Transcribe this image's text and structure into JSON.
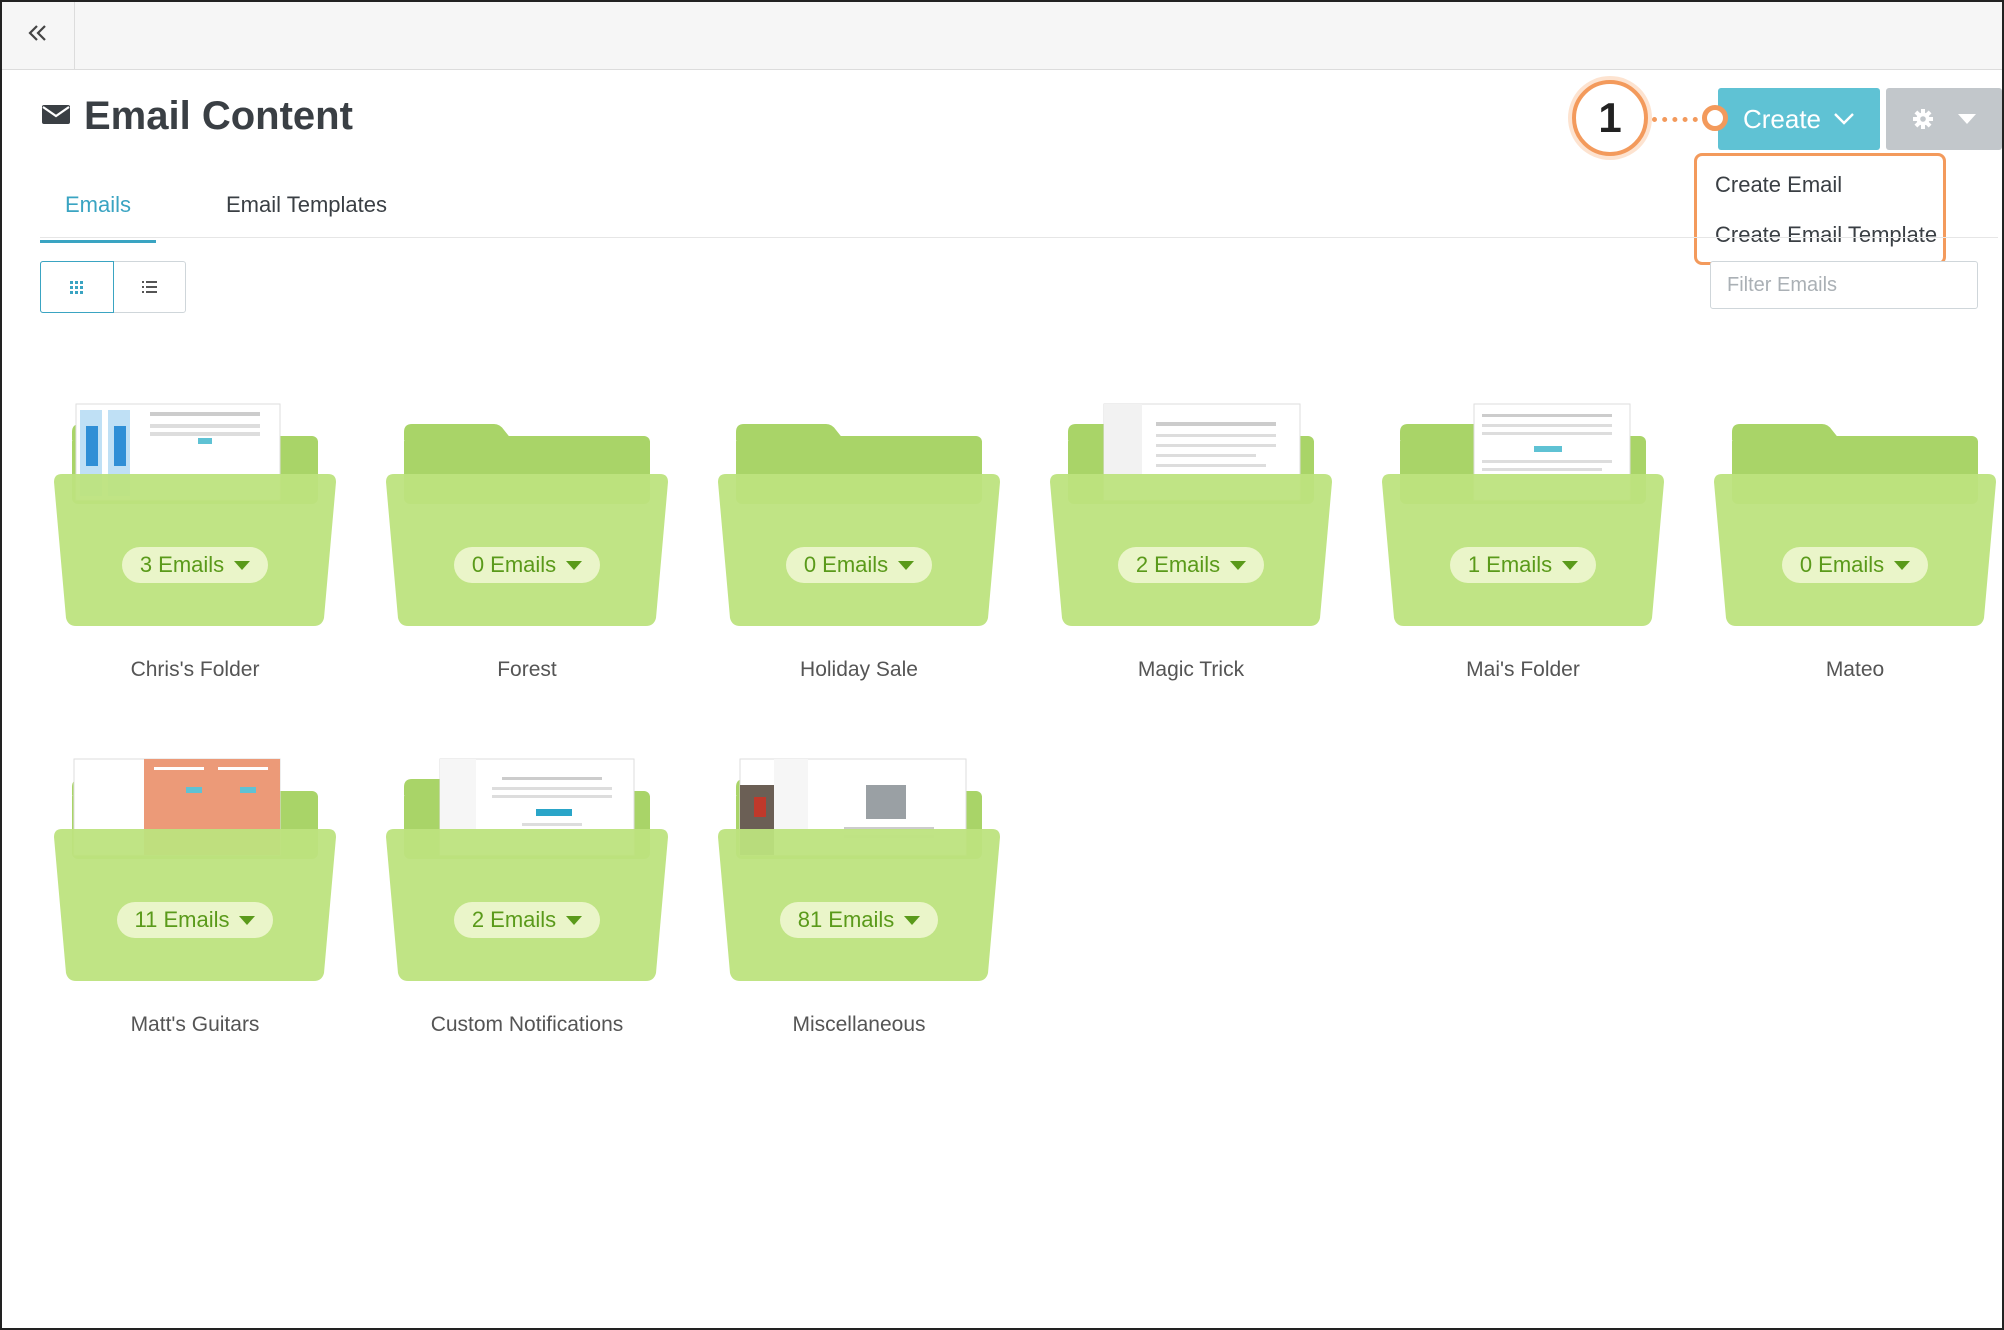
{
  "header": {
    "title": "Email Content"
  },
  "tabs": [
    {
      "label": "Emails",
      "active": true
    },
    {
      "label": "Email Templates",
      "active": false
    }
  ],
  "toolbar": {
    "create_label": "Create",
    "create_menu": [
      "Create Email",
      "Create Email Template"
    ],
    "filter_placeholder": "Filter Emails"
  },
  "callout": {
    "number": "1"
  },
  "folders": [
    {
      "name": "Chris's Folder",
      "count": "3 Emails"
    },
    {
      "name": "Forest",
      "count": "0 Emails"
    },
    {
      "name": "Holiday Sale",
      "count": "0 Emails"
    },
    {
      "name": "Magic Trick",
      "count": "2 Emails"
    },
    {
      "name": "Mai's Folder",
      "count": "1 Emails"
    },
    {
      "name": "Mateo",
      "count": "0 Emails"
    },
    {
      "name": "Matt's Guitars",
      "count": "11 Emails"
    },
    {
      "name": "Custom Notifications",
      "count": "2 Emails"
    },
    {
      "name": "Miscellaneous",
      "count": "81 Emails"
    }
  ],
  "colors": {
    "accent": "#5fc2d4",
    "folder": "#b7e07a",
    "callout": "#f39a5c"
  },
  "icons": [
    "double-chevron-left-icon",
    "envelope-icon",
    "grid-view-icon",
    "list-view-icon",
    "chevron-down-icon",
    "gear-icon",
    "caret-down-icon"
  ]
}
